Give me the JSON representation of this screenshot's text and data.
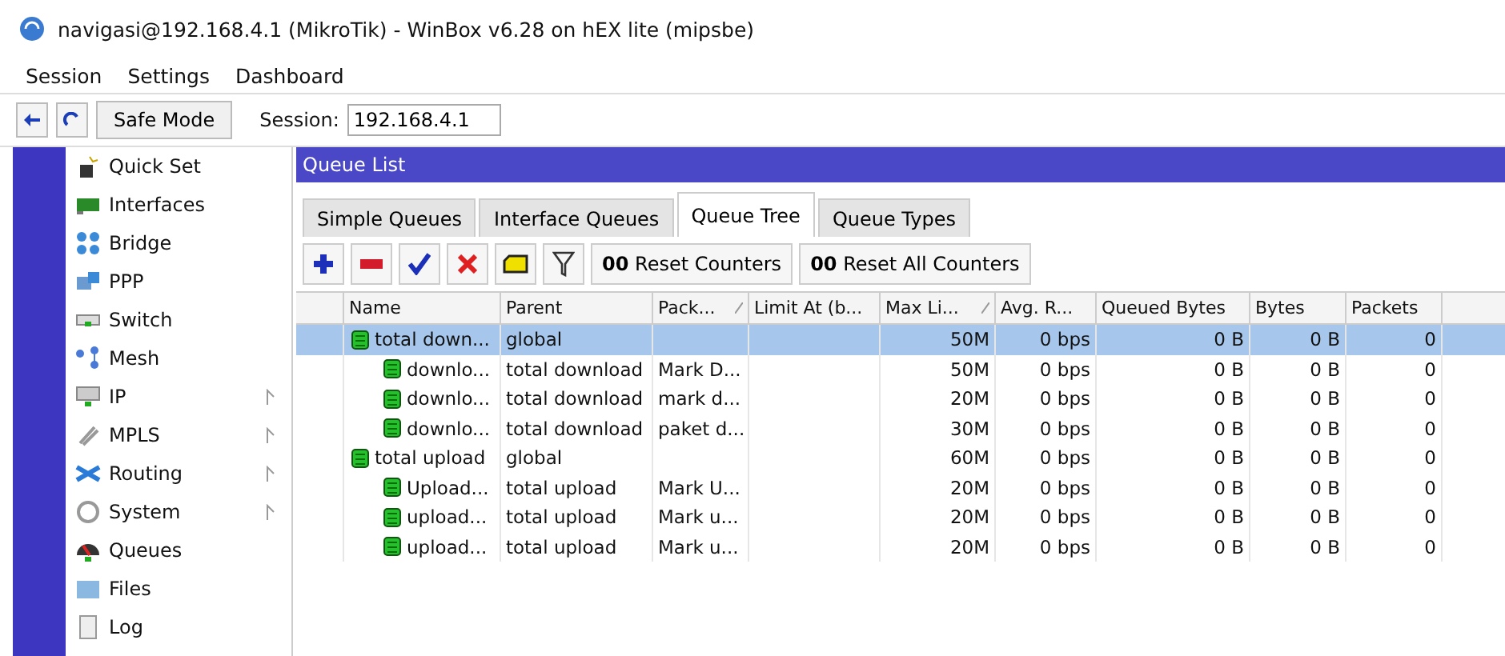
{
  "window": {
    "title": "navigasi@192.168.4.1 (MikroTik) - WinBox v6.28 on hEX lite (mipsbe)"
  },
  "menu": [
    "Session",
    "Settings",
    "Dashboard"
  ],
  "toolbar": {
    "safe_mode": "Safe Mode",
    "session_label": "Session:",
    "session_value": "192.168.4.1"
  },
  "sidebar": {
    "items": [
      {
        "label": "Quick Set",
        "submenu": false
      },
      {
        "label": "Interfaces",
        "submenu": false
      },
      {
        "label": "Bridge",
        "submenu": false
      },
      {
        "label": "PPP",
        "submenu": false
      },
      {
        "label": "Switch",
        "submenu": false
      },
      {
        "label": "Mesh",
        "submenu": false
      },
      {
        "label": "IP",
        "submenu": true
      },
      {
        "label": "MPLS",
        "submenu": true
      },
      {
        "label": "Routing",
        "submenu": true
      },
      {
        "label": "System",
        "submenu": true
      },
      {
        "label": "Queues",
        "submenu": false
      },
      {
        "label": "Files",
        "submenu": false
      },
      {
        "label": "Log",
        "submenu": false
      }
    ]
  },
  "panel": {
    "title": "Queue List",
    "tabs": [
      {
        "label": "Simple Queues",
        "selected": false
      },
      {
        "label": "Interface Queues",
        "selected": false
      },
      {
        "label": "Queue Tree",
        "selected": true
      },
      {
        "label": "Queue Types",
        "selected": false
      }
    ],
    "actions": [
      {
        "kind": "add"
      },
      {
        "kind": "remove"
      },
      {
        "kind": "enable"
      },
      {
        "kind": "disable"
      },
      {
        "kind": "comment"
      },
      {
        "kind": "filter"
      },
      {
        "kind": "text",
        "label": "**00** Reset Counters"
      },
      {
        "kind": "text",
        "label": "**00** Reset All Counters"
      }
    ],
    "table": {
      "columns": [
        {
          "label": "Name",
          "sort_mark": false
        },
        {
          "label": "Parent",
          "sort_mark": false
        },
        {
          "label": "Pack...",
          "sort_mark": true
        },
        {
          "label": "Limit At (b...",
          "sort_mark": false
        },
        {
          "label": "Max Li...",
          "sort_mark": true
        },
        {
          "label": "Avg. R...",
          "sort_mark": false
        },
        {
          "label": "Queued Bytes",
          "sort_mark": false
        },
        {
          "label": "Bytes",
          "sort_mark": false
        },
        {
          "label": "Packets",
          "sort_mark": false
        }
      ],
      "rows": [
        {
          "cells": [
            "total down...",
            "global",
            "",
            "",
            "50M",
            "0 bps",
            "0 B",
            "0 B",
            "0"
          ],
          "selected": true,
          "children": [
            {
              "cells": [
                "downlo...",
                "total download",
                "Mark D...",
                "",
                "50M",
                "0 bps",
                "0 B",
                "0 B",
                "0"
              ],
              "selected": false
            },
            {
              "cells": [
                "downlo...",
                "total download",
                "mark d...",
                "",
                "20M",
                "0 bps",
                "0 B",
                "0 B",
                "0"
              ],
              "selected": false
            },
            {
              "cells": [
                "downlo...",
                "total download",
                "paket d...",
                "",
                "30M",
                "0 bps",
                "0 B",
                "0 B",
                "0"
              ],
              "selected": false
            }
          ]
        },
        {
          "cells": [
            "total upload",
            "global",
            "",
            "",
            "60M",
            "0 bps",
            "0 B",
            "0 B",
            "0"
          ],
          "selected": false,
          "children": [
            {
              "cells": [
                "Upload...",
                "total upload",
                "Mark U...",
                "",
                "20M",
                "0 bps",
                "0 B",
                "0 B",
                "0"
              ],
              "selected": false
            },
            {
              "cells": [
                "upload...",
                "total upload",
                "Mark u...",
                "",
                "20M",
                "0 bps",
                "0 B",
                "0 B",
                "0"
              ],
              "selected": false
            },
            {
              "cells": [
                "upload...",
                "total upload",
                "Mark u...",
                "",
                "20M",
                "0 bps",
                "0 B",
                "0 B",
                "0"
              ],
              "selected": false
            }
          ]
        }
      ]
    }
  }
}
